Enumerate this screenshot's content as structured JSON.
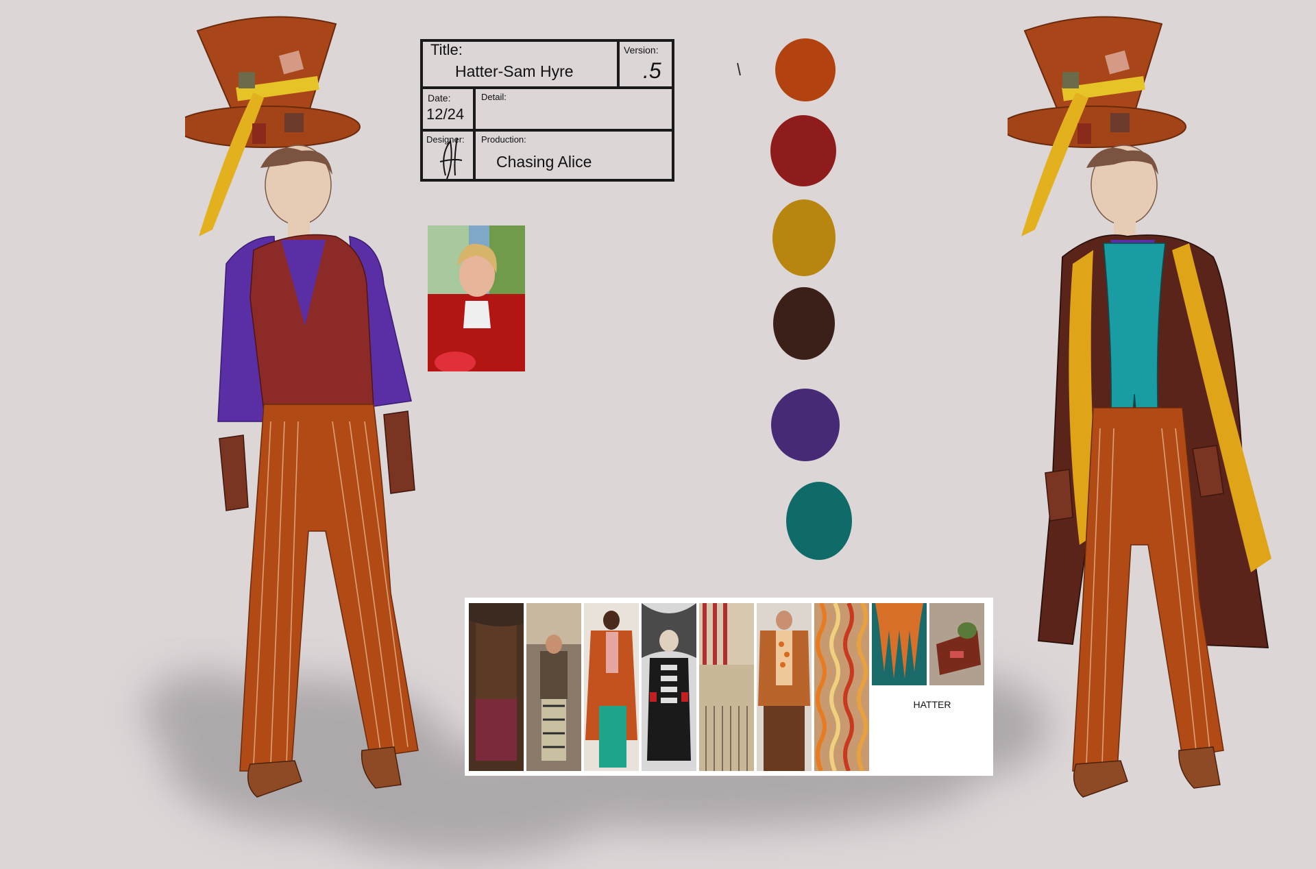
{
  "title_block": {
    "title_label": "Title:",
    "title_value": "Hatter-Sam Hyre",
    "version_label": "Version:",
    "version_value": ".5",
    "date_label": "Date:",
    "date_value": "12/24",
    "detail_label": "Detail:",
    "designer_label": "Designer:",
    "production_label": "Production:",
    "production_value": "Chasing Alice"
  },
  "palette": {
    "swatches": [
      "#b24310",
      "#8f1c1d",
      "#b8860f",
      "#3b2019",
      "#472a75",
      "#0f6b68"
    ]
  },
  "moodboard": {
    "caption": "HATTER",
    "thumb_count": 9
  }
}
